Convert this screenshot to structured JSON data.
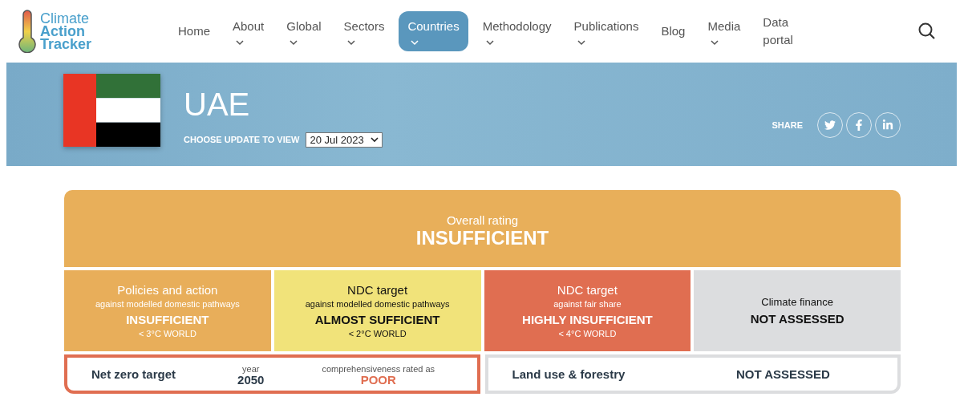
{
  "logo": {
    "lines": [
      "Climate",
      "Action",
      "Tracker"
    ]
  },
  "nav": [
    {
      "label": "Home",
      "dropdown": false,
      "selected": false
    },
    {
      "label": "About",
      "dropdown": true,
      "selected": false
    },
    {
      "label": "Global",
      "dropdown": true,
      "selected": false
    },
    {
      "label": "Sectors",
      "dropdown": true,
      "selected": false
    },
    {
      "label": "Countries",
      "dropdown": true,
      "selected": true
    },
    {
      "label": "Methodology",
      "dropdown": true,
      "selected": false
    },
    {
      "label": "Publications",
      "dropdown": true,
      "selected": false
    },
    {
      "label": "Blog",
      "dropdown": false,
      "selected": false
    },
    {
      "label": "Media",
      "dropdown": true,
      "selected": false
    },
    {
      "label": "Data portal",
      "dropdown": false,
      "selected": false
    }
  ],
  "banner": {
    "country": "UAE",
    "update_label": "CHOOSE UPDATE TO VIEW",
    "update_value": "20 Jul 2023",
    "share_label": "SHARE",
    "share": [
      {
        "kind": "twitter"
      },
      {
        "kind": "facebook"
      },
      {
        "kind": "linkedin"
      }
    ]
  },
  "overall": {
    "label": "Overall rating",
    "rating": "INSUFFICIENT",
    "color": "#e8af5a"
  },
  "ratings": [
    {
      "title": "Policies and action",
      "subtitle": "against modelled domestic pathways",
      "rating": "INSUFFICIENT",
      "world": "< 3°C WORLD",
      "color": "#e8ae5a"
    },
    {
      "title": "NDC target",
      "subtitle": "against modelled domestic pathways",
      "rating": "ALMOST SUFFICIENT",
      "world": "< 2°C WORLD",
      "color": "#f1e37a"
    },
    {
      "title": "NDC target",
      "subtitle": "against fair share",
      "rating": "HIGHLY INSUFFICIENT",
      "world": "< 4°C WORLD",
      "color": "#e06e51"
    },
    {
      "subtitle": "Climate finance",
      "rating": "NOT ASSESSED",
      "color": "#dcdddf"
    }
  ],
  "targets": [
    {
      "label": "Net zero target",
      "year_label": "year",
      "year": "2050",
      "rated_label": "comprehensiveness rated as",
      "rating": "POOR",
      "color": "#e06e51"
    },
    {
      "label": "Land use & forestry",
      "rating": "NOT ASSESSED",
      "color": "#dcdddf"
    }
  ]
}
